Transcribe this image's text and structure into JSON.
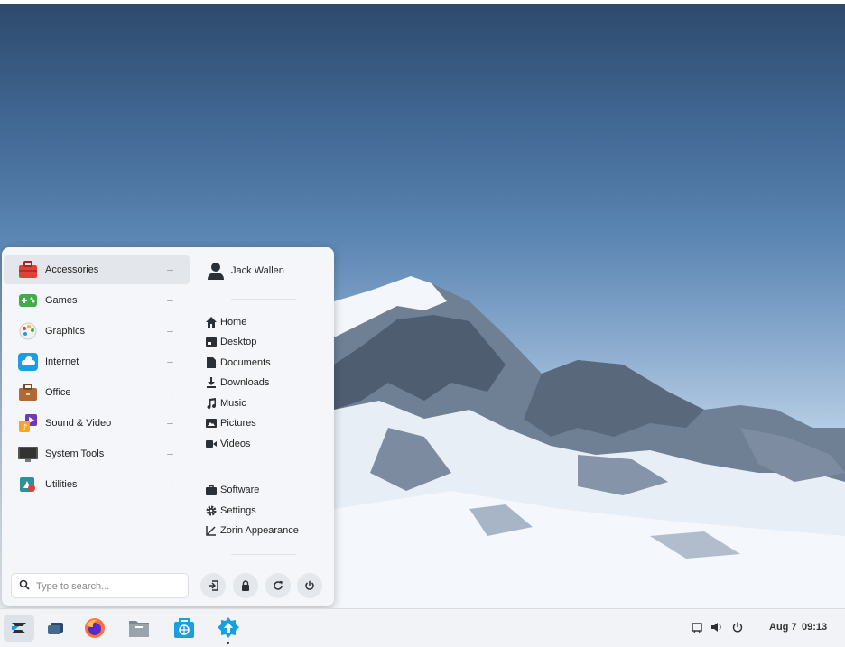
{
  "menu": {
    "categories": [
      {
        "label": "Accessories",
        "icon": "toolbox-icon",
        "active": true
      },
      {
        "label": "Games",
        "icon": "gamepad-icon"
      },
      {
        "label": "Graphics",
        "icon": "palette-icon"
      },
      {
        "label": "Internet",
        "icon": "cloud-icon"
      },
      {
        "label": "Office",
        "icon": "briefcase-icon"
      },
      {
        "label": "Sound & Video",
        "icon": "media-icon"
      },
      {
        "label": "System Tools",
        "icon": "monitor-icon"
      },
      {
        "label": "Utilities",
        "icon": "utilities-icon"
      }
    ],
    "arrow": "→",
    "user": {
      "name": "Jack Wallen"
    },
    "places": [
      {
        "label": "Home",
        "icon": "home-icon"
      },
      {
        "label": "Desktop",
        "icon": "desktop-icon"
      },
      {
        "label": "Documents",
        "icon": "document-icon"
      },
      {
        "label": "Downloads",
        "icon": "download-icon"
      },
      {
        "label": "Music",
        "icon": "music-icon"
      },
      {
        "label": "Pictures",
        "icon": "picture-icon"
      },
      {
        "label": "Videos",
        "icon": "video-icon"
      }
    ],
    "system": [
      {
        "label": "Software",
        "icon": "software-bag-icon"
      },
      {
        "label": "Settings",
        "icon": "gear-icon"
      },
      {
        "label": "Zorin Appearance",
        "icon": "appearance-icon"
      }
    ],
    "search": {
      "placeholder": "Type to search..."
    },
    "session_buttons": [
      "logout-icon",
      "lock-icon",
      "restart-icon",
      "power-icon"
    ]
  },
  "taskbar": {
    "apps": [
      "zorin-menu-icon",
      "windows-icon",
      "firefox-icon",
      "files-icon",
      "software-store-icon",
      "updates-icon"
    ],
    "date": "Aug 7",
    "time": "09:13"
  },
  "colors": {
    "accent": "#1a9ee0",
    "panel": "#f4f6f9"
  }
}
